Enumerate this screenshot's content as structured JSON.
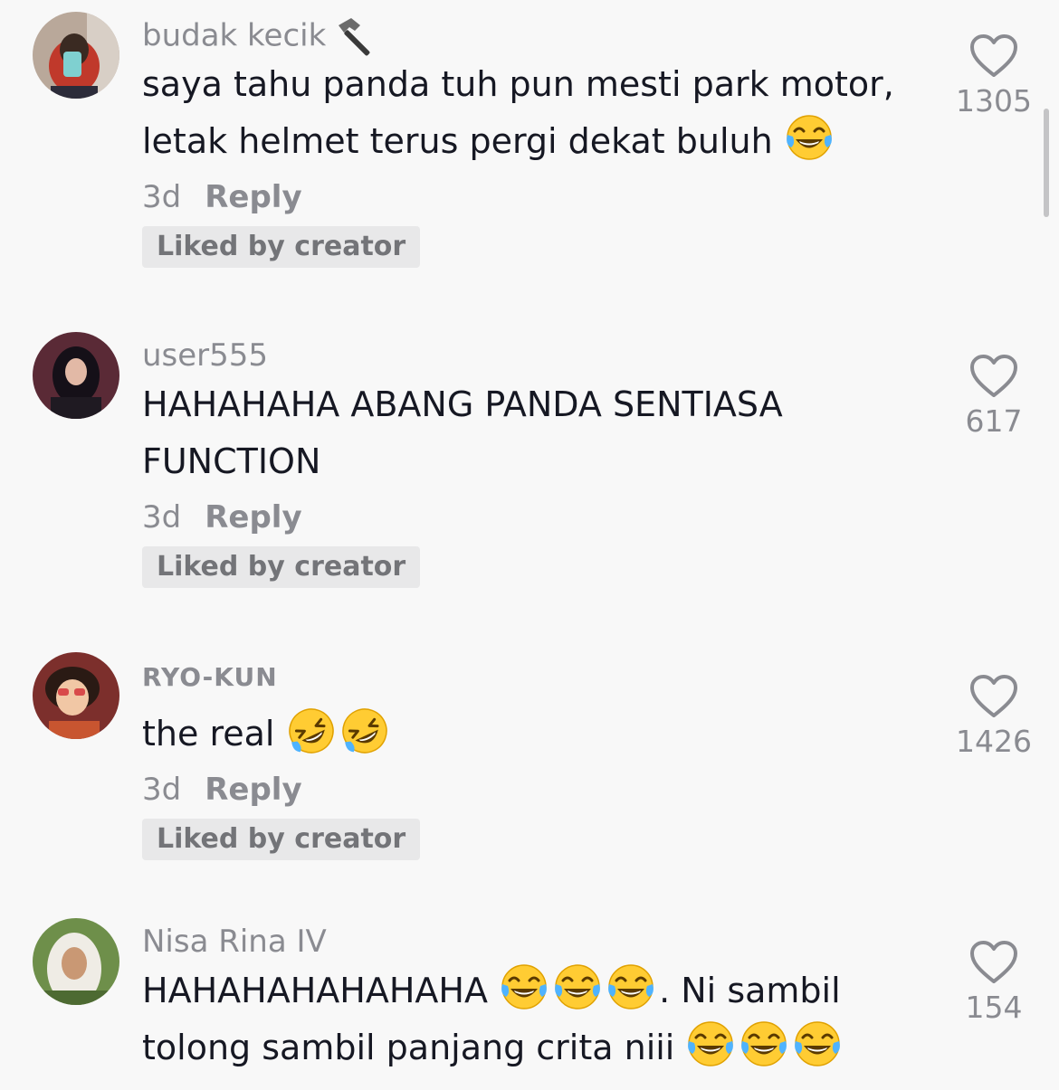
{
  "comments": [
    {
      "username": "budak kecik",
      "username_icon": "hammer-icon",
      "line1": "saya tahu panda tuh pun mesti park motor,",
      "line2": "letak helmet terus pergi dekat buluh",
      "emoji": "tears-of-joy-emoji",
      "time": "3d",
      "reply": "Reply",
      "badge": "Liked by creator",
      "likes": "1305"
    },
    {
      "username": "user555",
      "line1": "HAHAHAHA ABANG PANDA SENTIASA",
      "line2": "FUNCTION",
      "time": "3d",
      "reply": "Reply",
      "badge": "Liked by creator",
      "likes": "617"
    },
    {
      "username": "RYO-KUN",
      "line1": "the real",
      "emoji": "rolling-on-floor-laughing-emoji",
      "time": "3d",
      "reply": "Reply",
      "badge": "Liked by creator",
      "likes": "1426"
    },
    {
      "username": "Nisa Rina IV",
      "line1a": "HAHAHAHAHAHAHA",
      "line1b": ". Ni sambil",
      "line2": "tolong sambil panjang crita niii",
      "emoji": "tears-of-joy-emoji",
      "likes": "154"
    }
  ],
  "colors": {
    "background": "#f8f8f8",
    "text": "#161823",
    "secondary": "#8a8b91",
    "badge_bg": "#e8e8e9"
  }
}
